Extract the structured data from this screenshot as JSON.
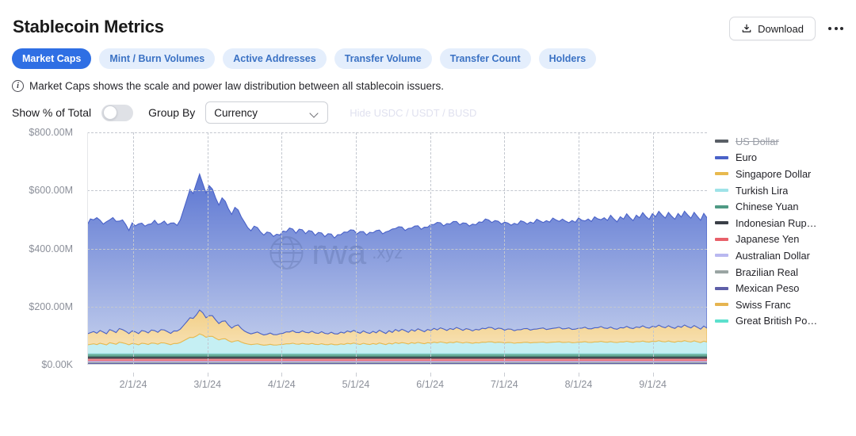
{
  "header": {
    "title": "Stablecoin Metrics",
    "download_label": "Download",
    "download_icon": "download-tray-icon",
    "more_icon": "ellipsis-icon"
  },
  "tabs": [
    {
      "label": "Market Caps",
      "active": true
    },
    {
      "label": "Mint / Burn Volumes",
      "active": false
    },
    {
      "label": "Active Addresses",
      "active": false
    },
    {
      "label": "Transfer Volume",
      "active": false
    },
    {
      "label": "Transfer Count",
      "active": false
    },
    {
      "label": "Holders",
      "active": false
    }
  ],
  "info": {
    "icon": "info-circle-icon",
    "text": "Market Caps shows the scale and power law distribution between all stablecoin issuers."
  },
  "controls": {
    "toggle_label": "Show % of Total",
    "toggle_on": false,
    "group_by_label": "Group By",
    "group_by_value": "Currency",
    "group_by_options": [
      "Currency"
    ],
    "hide_link_label": "Hide USDC / USDT / BUSD",
    "hide_link_disabled": true
  },
  "watermark": {
    "text": "rwa",
    "suffix": ".xyz",
    "icon": "globe-icon"
  },
  "colors": {
    "accent": "#2f6fe4",
    "tab_inactive_bg": "#e4eefc",
    "tab_inactive_text": "#3b72c4",
    "grid": "#c3c7cf",
    "axis_text": "#8b8f99"
  },
  "chart_data": {
    "type": "area",
    "stacked": true,
    "title": "",
    "xlabel": "",
    "ylabel": "",
    "ylim": [
      0,
      800
    ],
    "y_unit": "M",
    "grid": true,
    "legend_position": "right",
    "y_ticks": [
      {
        "value": 800,
        "label": "$800.00M"
      },
      {
        "value": 600,
        "label": "$600.00M"
      },
      {
        "value": 400,
        "label": "$400.00M"
      },
      {
        "value": 200,
        "label": "$200.00M"
      },
      {
        "value": 0,
        "label": "$0.00K"
      }
    ],
    "x_ticks": [
      "2/1/24",
      "3/1/24",
      "4/1/24",
      "5/1/24",
      "6/1/24",
      "7/1/24",
      "8/1/24",
      "9/1/24"
    ],
    "series": [
      {
        "name": "US Dollar",
        "color": "#5a5f66",
        "hidden": true,
        "values": []
      },
      {
        "name": "Euro",
        "color": "#4a62c8",
        "fill": "#5d78d4",
        "values": [
          375,
          392,
          385,
          398,
          380,
          372,
          386,
          378,
          390,
          383,
          370,
          378,
          368,
          355,
          372,
          365,
          378,
          370,
          362,
          374,
          366,
          380,
          372,
          366,
          375,
          368,
          380,
          372,
          364,
          376,
          398,
          420,
          442,
          430,
          452,
          468,
          445,
          430,
          448,
          436,
          420,
          408,
          425,
          412,
          400,
          392,
          408,
          396,
          384,
          375,
          362,
          355,
          368,
          360,
          350,
          344,
          352,
          345,
          338,
          346,
          340,
          352,
          345,
          358,
          350,
          342,
          356,
          348,
          340,
          352,
          344,
          336,
          348,
          340,
          333,
          345,
          338,
          330,
          342,
          336,
          348,
          340,
          352,
          345,
          338,
          350,
          342,
          336,
          348,
          340,
          352,
          345,
          338,
          350,
          344,
          356,
          348,
          360,
          352,
          345,
          358,
          350,
          362,
          355,
          348,
          360,
          352,
          365,
          358,
          370,
          362,
          355,
          368,
          360,
          372,
          365,
          358,
          370,
          363,
          356,
          368,
          360,
          372,
          365,
          378,
          370,
          362,
          375,
          368,
          360,
          372,
          365,
          358,
          370,
          362,
          375,
          368,
          360,
          372,
          365,
          378,
          370,
          363,
          375,
          368,
          380,
          372,
          365,
          378,
          370,
          362,
          375,
          368,
          380,
          372,
          366,
          378,
          370,
          382,
          375,
          368,
          380,
          372,
          385,
          378,
          370,
          382,
          375,
          388,
          380,
          372,
          385,
          378,
          390,
          382,
          375,
          388,
          380,
          392,
          385,
          378,
          390,
          383,
          376,
          388,
          380,
          392,
          385,
          378,
          390,
          382,
          375,
          388,
          380
        ]
      },
      {
        "name": "Singapore Dollar",
        "color": "#e8b94e",
        "fill": "#f0cd84",
        "values": [
          38,
          40,
          42,
          39,
          44,
          41,
          38,
          46,
          43,
          40,
          48,
          45,
          42,
          38,
          44,
          41,
          38,
          45,
          42,
          39,
          46,
          43,
          40,
          47,
          44,
          41,
          38,
          45,
          42,
          48,
          55,
          62,
          70,
          64,
          78,
          85,
          72,
          64,
          76,
          68,
          60,
          54,
          66,
          58,
          50,
          46,
          58,
          50,
          44,
          40,
          38,
          36,
          42,
          39,
          36,
          34,
          40,
          37,
          34,
          38,
          36,
          42,
          39,
          44,
          41,
          38,
          44,
          41,
          38,
          43,
          40,
          37,
          42,
          39,
          36,
          41,
          38,
          36,
          41,
          38,
          43,
          40,
          44,
          41,
          38,
          43,
          40,
          38,
          42,
          39,
          44,
          41,
          38,
          43,
          40,
          45,
          42,
          46,
          43,
          40,
          45,
          42,
          47,
          44,
          41,
          46,
          43,
          48,
          44,
          49,
          46,
          43,
          48,
          45,
          50,
          46,
          43,
          48,
          45,
          42,
          47,
          44,
          49,
          46,
          51,
          48,
          44,
          50,
          46,
          43,
          48,
          45,
          42,
          47,
          44,
          49,
          46,
          43,
          48,
          45,
          50,
          47,
          44,
          49,
          46,
          51,
          48,
          45,
          50,
          47,
          44,
          49,
          46,
          51,
          48,
          45,
          50,
          47,
          52,
          49,
          46,
          51,
          48,
          44,
          50,
          47,
          52,
          49,
          46,
          51,
          48,
          53,
          50,
          47,
          52,
          49,
          54,
          51,
          48,
          53,
          50,
          47,
          52,
          49,
          54,
          51,
          48,
          53,
          50,
          46,
          52,
          48
        ]
      },
      {
        "name": "Turkish Lira",
        "color": "#9fe3e8",
        "fill": "#c5eff3",
        "values": [
          30,
          32,
          34,
          31,
          36,
          33,
          30,
          38,
          35,
          32,
          40,
          37,
          34,
          30,
          36,
          33,
          30,
          37,
          34,
          31,
          38,
          35,
          32,
          39,
          36,
          33,
          30,
          37,
          34,
          40,
          46,
          52,
          58,
          54,
          64,
          70,
          60,
          54,
          63,
          57,
          50,
          45,
          55,
          48,
          42,
          38,
          48,
          42,
          37,
          34,
          32,
          30,
          35,
          32,
          30,
          28,
          33,
          31,
          28,
          32,
          30,
          35,
          32,
          37,
          34,
          31,
          36,
          34,
          31,
          36,
          33,
          30,
          35,
          32,
          30,
          34,
          31,
          30,
          34,
          31,
          36,
          33,
          37,
          34,
          31,
          36,
          33,
          31,
          35,
          32,
          37,
          34,
          31,
          36,
          33,
          38,
          35,
          38,
          36,
          33,
          38,
          35,
          39,
          36,
          34,
          38,
          36,
          40,
          37,
          41,
          38,
          36,
          40,
          37,
          42,
          38,
          36,
          40,
          37,
          35,
          39,
          36,
          41,
          38,
          42,
          40,
          37,
          41,
          38,
          36,
          40,
          37,
          35,
          39,
          36,
          41,
          38,
          36,
          40,
          37,
          41,
          39,
          36,
          41,
          38,
          42,
          40,
          37,
          41,
          39,
          36,
          41,
          38,
          42,
          40,
          37,
          41,
          39,
          43,
          41,
          38,
          42,
          40,
          37,
          41,
          39,
          43,
          41,
          38,
          42,
          40,
          44,
          41,
          39,
          43,
          41,
          45,
          42,
          40,
          44,
          41,
          39,
          43,
          41,
          45,
          42,
          40,
          44,
          41,
          38,
          43,
          40
        ]
      },
      {
        "name": "Chinese Yuan",
        "color": "#4f9a84",
        "fill": "#6cae9b",
        "values": [
          9
        ]
      },
      {
        "name": "Indonesian Rup…",
        "color": "#3a3f47",
        "fill": "#4a5058",
        "values": [
          7
        ]
      },
      {
        "name": "Japanese Yen",
        "color": "#e8606a",
        "fill": "#f08d95",
        "values": [
          8
        ]
      },
      {
        "name": "Australian Dollar",
        "color": "#b9b8f0",
        "fill": "#c9c8f5",
        "values": [
          4
        ]
      },
      {
        "name": "Brazilian Real",
        "color": "#9aa5a3",
        "fill": "#aab4b2",
        "values": [
          3
        ]
      },
      {
        "name": "Mexican Peso",
        "color": "#5e5fa8",
        "fill": "#7375bb",
        "values": [
          3
        ]
      },
      {
        "name": "Swiss Franc",
        "color": "#e6b450",
        "fill": "#efc878",
        "values": [
          2
        ]
      },
      {
        "name": "Great British Po…",
        "color": "#5ce0cd",
        "fill": "#8aeade",
        "values": [
          2
        ]
      }
    ]
  }
}
